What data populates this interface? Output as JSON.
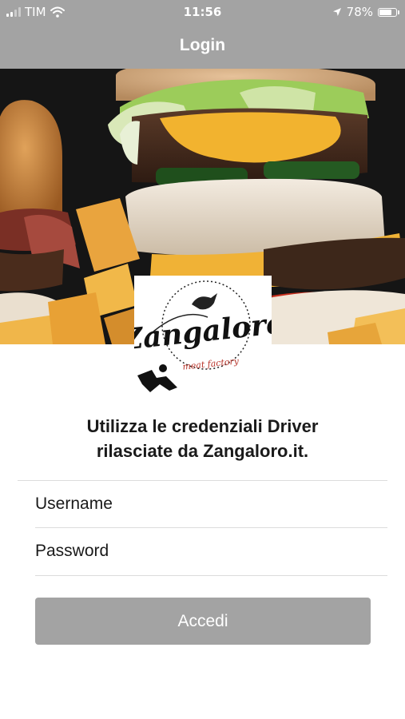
{
  "status_bar": {
    "carrier": "TIM",
    "time": "11:56",
    "battery_percent": "78%",
    "battery_level": 0.78,
    "icons": [
      "signal-icon",
      "wifi-icon",
      "location-arrow-icon",
      "battery-icon"
    ]
  },
  "nav": {
    "title": "Login"
  },
  "hero": {
    "image": "burgers-and-fries-photo"
  },
  "logo": {
    "brand": "Zangaloro",
    "tagline": "meat factory"
  },
  "instructions": {
    "line1": "Utilizza le credenziali Driver",
    "line2": "rilasciate da Zangaloro.it."
  },
  "form": {
    "username_placeholder": "Username",
    "password_placeholder": "Password",
    "submit_label": "Accedi"
  },
  "colors": {
    "bar_background": "#a3a3a3",
    "button_background": "#a3a3a3",
    "text": "#1a1a1a",
    "separator": "#dcdcdc"
  }
}
